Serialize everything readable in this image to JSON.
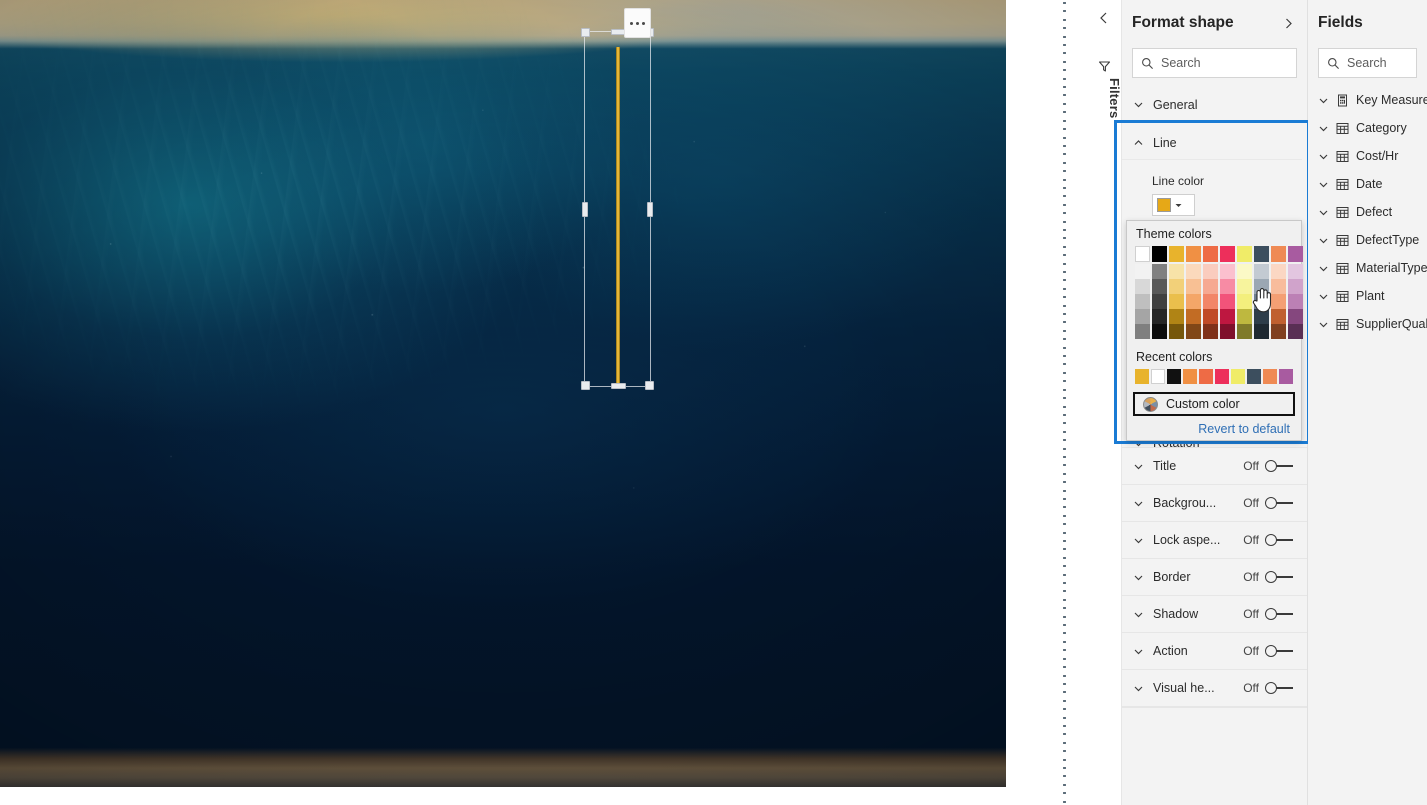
{
  "filters_rail": {
    "label": "Filters",
    "collapse_icon": "chevron-left-icon",
    "filter_icon": "filter-icon"
  },
  "format_pane": {
    "title": "Format shape",
    "expand_icon": "chevron-right-icon",
    "search": {
      "placeholder": "Search",
      "icon": "search-icon",
      "value": ""
    },
    "sections": [
      {
        "name": "General",
        "chevron": "chevron-down-icon",
        "toggle": null
      },
      {
        "name": "Title",
        "chevron": "chevron-down-icon",
        "toggle": "Off"
      },
      {
        "name": "Backgrou...",
        "chevron": "chevron-down-icon",
        "toggle": "Off"
      },
      {
        "name": "Lock aspe...",
        "chevron": "chevron-down-icon",
        "toggle": "Off"
      },
      {
        "name": "Border",
        "chevron": "chevron-down-icon",
        "toggle": "Off"
      },
      {
        "name": "Shadow",
        "chevron": "chevron-down-icon",
        "toggle": "Off"
      },
      {
        "name": "Action",
        "chevron": "chevron-down-icon",
        "toggle": "Off"
      },
      {
        "name": "Visual he...",
        "chevron": "chevron-down-icon",
        "toggle": "Off"
      }
    ],
    "line_section": {
      "name": "Line",
      "chevron": "chevron-up-icon",
      "expanded": true,
      "line_color_label": "Line color",
      "selected_color": "#E6A817",
      "dropdown_arrow": "chevron-down-icon",
      "highlight_color": "#1A7BD4"
    },
    "rotation_section": {
      "name": "Rotation",
      "chevron": "chevron-down-icon"
    }
  },
  "color_dropdown": {
    "theme_label": "Theme colors",
    "recent_label": "Recent colors",
    "custom_color_label": "Custom color",
    "custom_color_icon": "color-wheel-icon",
    "revert_label": "Revert to default",
    "theme_columns": [
      {
        "base": "#FFFFFF",
        "tints": [
          "#F2F2F2",
          "#D8D8D8",
          "#BFBFBF",
          "#A5A5A5",
          "#7F7F7F"
        ]
      },
      {
        "base": "#000000",
        "tints": [
          "#808080",
          "#595959",
          "#404040",
          "#262626",
          "#0D0D0D"
        ]
      },
      {
        "base": "#E8B32C",
        "tints": [
          "#F7E3A8",
          "#F2D079",
          "#EABF4C",
          "#B08415",
          "#76570B"
        ]
      },
      {
        "base": "#F09044",
        "tints": [
          "#FBD9BC",
          "#F8C094",
          "#F4A668",
          "#C26C24",
          "#814717"
        ]
      },
      {
        "base": "#EE6B45",
        "tints": [
          "#FACCBE",
          "#F6A992",
          "#F28668",
          "#C04A26",
          "#803119"
        ]
      },
      {
        "base": "#ED2F5B",
        "tints": [
          "#FBC0CE",
          "#F78BA4",
          "#F2537A",
          "#BE1740",
          "#7F0F2B"
        ]
      },
      {
        "base": "#F0EC68",
        "tints": [
          "#FBF9C6",
          "#F7F49D",
          "#F3EF7D",
          "#BEB83F",
          "#7F7A2A"
        ]
      },
      {
        "base": "#3C4E5E",
        "tints": [
          "#C3CAD2",
          "#9BA7B3",
          "#6F8091",
          "#2E3D4A",
          "#1E2831"
        ]
      },
      {
        "base": "#EF8A54",
        "tints": [
          "#FBD7C3",
          "#F8BC9C",
          "#F49F74",
          "#C06030",
          "#804020"
        ]
      },
      {
        "base": "#A85BA0",
        "tints": [
          "#E3C6E0",
          "#D0A3CB",
          "#BC80B5",
          "#85477E",
          "#592F54"
        ]
      }
    ],
    "recent_colors": [
      "#E8B32C",
      "#FFFFFF",
      "#111111",
      "#F09044",
      "#EE6B45",
      "#ED2F5B",
      "#F0EC68",
      "#3C4E5E",
      "#EF8A54",
      "#A85BA0"
    ]
  },
  "fields_pane": {
    "title": "Fields",
    "search": {
      "placeholder": "Search",
      "icon": "search-icon",
      "value": ""
    },
    "items": [
      {
        "label": "Key Measures",
        "icon": "measure-table-icon",
        "chevron": "chevron-down-icon"
      },
      {
        "label": "Category",
        "icon": "table-icon",
        "chevron": "chevron-down-icon"
      },
      {
        "label": "Cost/Hr",
        "icon": "table-icon",
        "chevron": "chevron-down-icon"
      },
      {
        "label": "Date",
        "icon": "table-icon",
        "chevron": "chevron-down-icon"
      },
      {
        "label": "Defect",
        "icon": "table-icon",
        "chevron": "chevron-down-icon"
      },
      {
        "label": "DefectType",
        "icon": "table-icon",
        "chevron": "chevron-down-icon"
      },
      {
        "label": "MaterialType",
        "icon": "table-icon",
        "chevron": "chevron-down-icon"
      },
      {
        "label": "Plant",
        "icon": "table-icon",
        "chevron": "chevron-down-icon"
      },
      {
        "label": "SupplierQuality",
        "icon": "table-icon",
        "chevron": "chevron-down-icon"
      }
    ]
  },
  "canvas": {
    "shape": {
      "type": "line-shape",
      "color": "#E0AE28",
      "selected": true,
      "more_options_label": "..."
    }
  }
}
